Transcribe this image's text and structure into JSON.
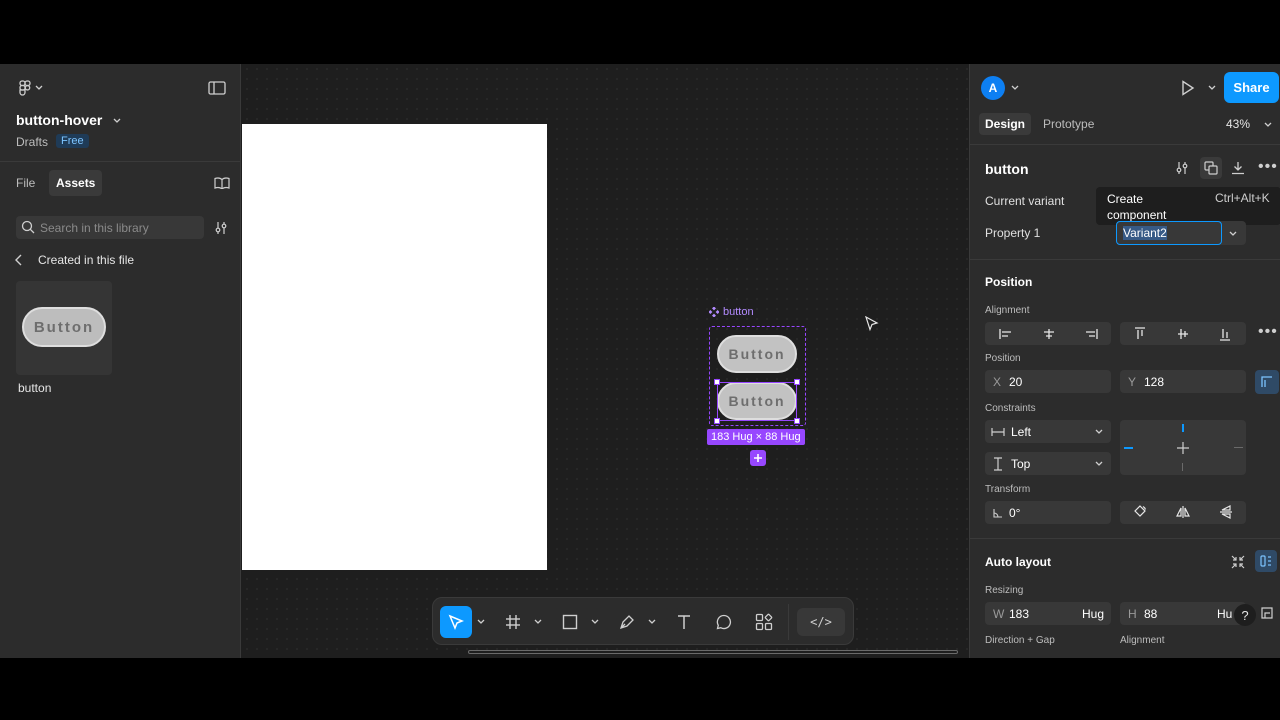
{
  "left_panel": {
    "file_name": "button-hover",
    "drafts_label": "Drafts",
    "plan_badge": "Free",
    "tab_file": "File",
    "tab_assets": "Assets",
    "search_placeholder": "Search in this library",
    "back_section": "Created in this file",
    "asset_thumb_text": "Button",
    "asset_name": "button"
  },
  "canvas": {
    "component_label": "button",
    "variant1_text": "Button",
    "variant2_text": "Button",
    "size_badge": "183 Hug × 88 Hug"
  },
  "toolbar": {
    "code_label": "</>"
  },
  "right_panel": {
    "avatar_letter": "A",
    "share_label": "Share",
    "tab_design": "Design",
    "tab_prototype": "Prototype",
    "zoom": "43%",
    "component_name": "button",
    "current_variant_label": "Current variant",
    "tooltip_title": "Create component",
    "tooltip_shortcut": "Ctrl+Alt+K",
    "property_label": "Property 1",
    "property_value": "Variant2",
    "position_heading": "Position",
    "alignment_label": "Alignment",
    "position_label": "Position",
    "x_label": "X",
    "x_value": "20",
    "y_label": "Y",
    "y_value": "128",
    "constraints_label": "Constraints",
    "constraint_h": "Left",
    "constraint_v": "Top",
    "transform_label": "Transform",
    "rotation_value": "0°",
    "auto_layout_heading": "Auto layout",
    "resizing_label": "Resizing",
    "w_label": "W",
    "w_value": "183",
    "w_mode": "Hug",
    "h_label": "H",
    "h_value": "88",
    "h_mode": "Hu",
    "help_label": "?",
    "direction_gap_label": "Direction + Gap",
    "alignment2_label": "Alignment"
  },
  "colors": {
    "accent_blue": "#0d99ff",
    "selection_purple": "#9747ff",
    "panel_bg": "#2c2c2c",
    "canvas_bg": "#1e1e1e"
  }
}
